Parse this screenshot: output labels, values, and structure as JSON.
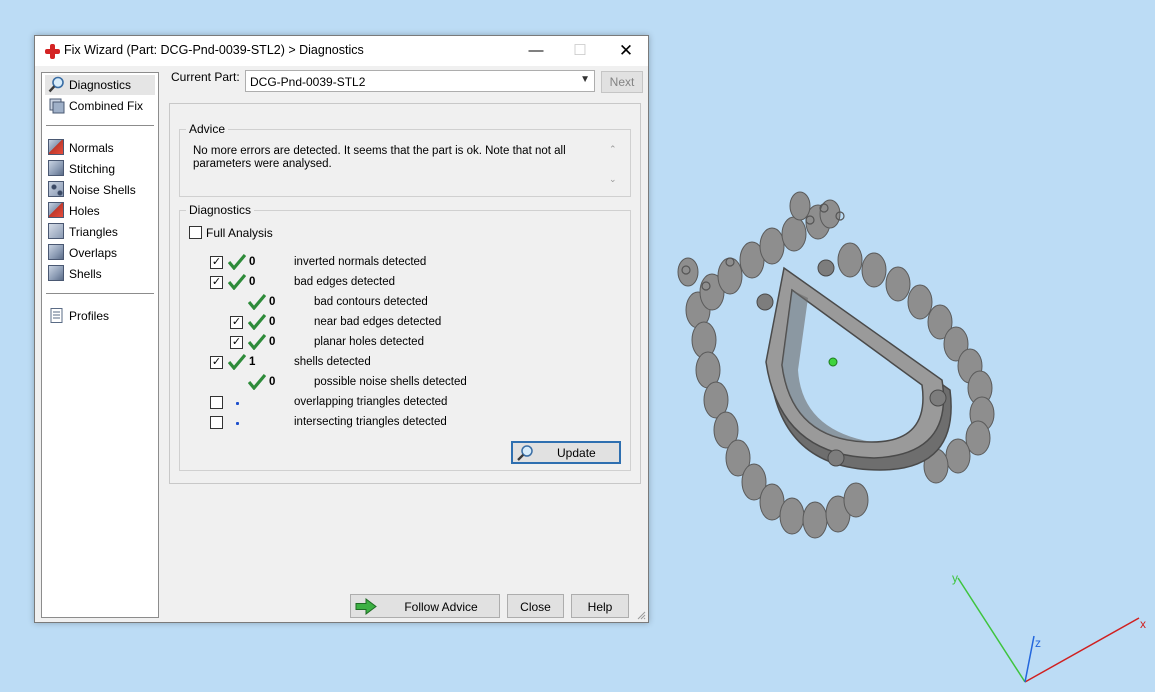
{
  "window": {
    "title": "Fix Wizard (Part: DCG-Pnd-0039-STL2) > Diagnostics",
    "controls": {
      "minimize": "—",
      "maximize": "☐",
      "close": "✕"
    }
  },
  "nav": {
    "items": [
      {
        "label": "Diagnostics",
        "icon": "magnifier-icon",
        "selected": true
      },
      {
        "label": "Combined Fix",
        "icon": "combined-fix-icon"
      },
      {
        "label": "Normals",
        "icon": "normals-cube-icon"
      },
      {
        "label": "Stitching",
        "icon": "stitching-cube-icon"
      },
      {
        "label": "Noise Shells",
        "icon": "noise-shells-cube-icon"
      },
      {
        "label": "Holes",
        "icon": "holes-cube-icon"
      },
      {
        "label": "Triangles",
        "icon": "triangles-cube-icon"
      },
      {
        "label": "Overlaps",
        "icon": "overlaps-cube-icon"
      },
      {
        "label": "Shells",
        "icon": "shells-cube-icon"
      },
      {
        "label": "Profiles",
        "icon": "profiles-icon"
      }
    ]
  },
  "current_part": {
    "label": "Current Part:",
    "value": "DCG-Pnd-0039-STL2",
    "next_label": "Next"
  },
  "advice": {
    "title": "Advice",
    "text": "No more errors are detected. It seems that the part is ok. Note that not all parameters were analysed."
  },
  "diagnostics": {
    "title": "Diagnostics",
    "full_analysis_label": "Full Analysis",
    "full_analysis_checked": false,
    "rows": [
      {
        "checkbox": true,
        "checked": true,
        "status": "ok",
        "count": "0",
        "text": "inverted normals detected",
        "indent": 0
      },
      {
        "checkbox": true,
        "checked": true,
        "status": "ok",
        "count": "0",
        "text": "bad edges detected",
        "indent": 0
      },
      {
        "checkbox": false,
        "checked": false,
        "status": "ok",
        "count": "0",
        "text": "bad contours detected",
        "indent": 1
      },
      {
        "checkbox": true,
        "checked": true,
        "status": "ok",
        "count": "0",
        "text": "near bad edges detected",
        "indent": 1
      },
      {
        "checkbox": true,
        "checked": true,
        "status": "ok",
        "count": "0",
        "text": "planar holes detected",
        "indent": 1
      },
      {
        "checkbox": true,
        "checked": true,
        "status": "ok",
        "count": "1",
        "text": "shells detected",
        "indent": 0
      },
      {
        "checkbox": false,
        "checked": false,
        "status": "ok",
        "count": "0",
        "text": "possible noise shells detected",
        "indent": 1
      },
      {
        "checkbox": true,
        "checked": false,
        "status": "pending",
        "count": "",
        "text": "overlapping triangles detected",
        "indent": 0
      },
      {
        "checkbox": true,
        "checked": false,
        "status": "pending",
        "count": "",
        "text": "intersecting triangles detected",
        "indent": 0
      }
    ],
    "update_label": "Update"
  },
  "buttons": {
    "follow_advice": "Follow Advice",
    "close": "Close",
    "help": "Help"
  },
  "viewport": {
    "axis_labels": {
      "x": "x",
      "y": "y",
      "z": "z"
    }
  },
  "colors": {
    "desktop_bg": "#bcdcf5",
    "check_green": "#2e8b3a",
    "axis_x": "#d02020",
    "axis_y": "#3ec43e",
    "axis_z": "#2266dd",
    "model_gray": "#8c8c8c"
  }
}
